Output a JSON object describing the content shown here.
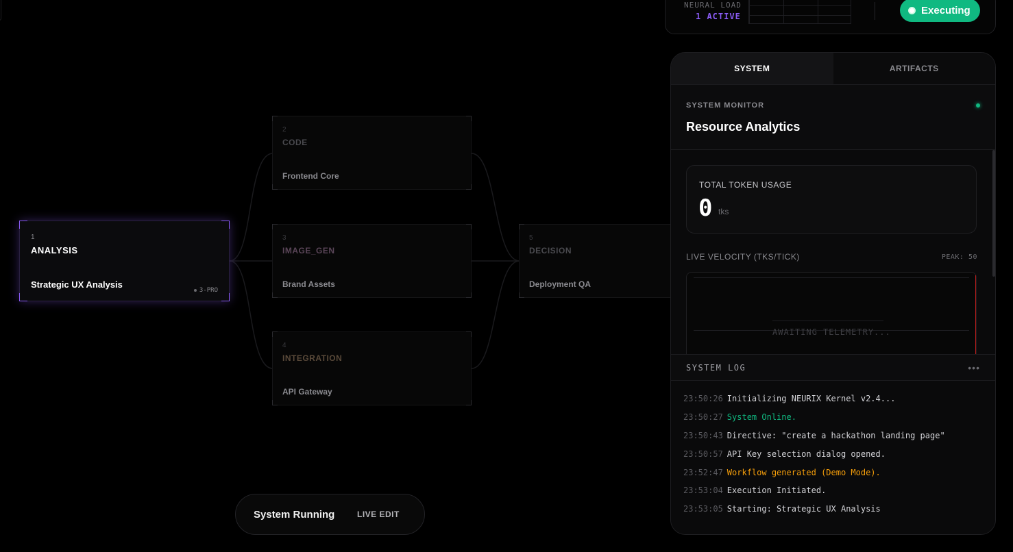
{
  "topbar": {
    "neural_label": "NEURAL LOAD",
    "neural_value": "1 ACTIVE",
    "exec_label": "Executing"
  },
  "nodes": [
    {
      "num": "1",
      "type": "ANALYSIS",
      "title": "Strategic UX Analysis",
      "model": "3-PRO"
    },
    {
      "num": "2",
      "type": "CODE",
      "title": "Frontend Core"
    },
    {
      "num": "3",
      "type": "IMAGE_GEN",
      "title": "Brand Assets"
    },
    {
      "num": "4",
      "type": "INTEGRATION",
      "title": "API Gateway"
    },
    {
      "num": "5",
      "type": "DECISION",
      "title": "Deployment QA"
    }
  ],
  "pill": {
    "status": "System Running",
    "edit": "LIVE EDIT"
  },
  "panel": {
    "tabs": [
      "SYSTEM",
      "ARTIFACTS"
    ],
    "monitor_label": "SYSTEM MONITOR",
    "monitor_title": "Resource Analytics",
    "token_label": "TOTAL TOKEN USAGE",
    "token_value": "0",
    "token_unit": "tks",
    "velocity_label": "LIVE VELOCITY (TKS/TICK)",
    "velocity_peak": "PEAK: 50",
    "awaiting": "AWAITING TELEMETRY...",
    "log_title": "SYSTEM LOG",
    "log_more": "•••"
  },
  "log": [
    {
      "time": "23:50:26",
      "msg": "Initializing NEURIX Kernel v2.4...",
      "tone": "normal"
    },
    {
      "time": "23:50:27",
      "msg": "System Online.",
      "tone": "green"
    },
    {
      "time": "23:50:43",
      "msg": "Directive: \"create a hackathon landing page\"",
      "tone": "normal"
    },
    {
      "time": "23:50:57",
      "msg": "API Key selection dialog opened.",
      "tone": "normal"
    },
    {
      "time": "23:52:47",
      "msg": "Workflow generated (Demo Mode).",
      "tone": "orange"
    },
    {
      "time": "23:53:04",
      "msg": "Execution Initiated.",
      "tone": "normal"
    },
    {
      "time": "23:53:05",
      "msg": "Starting: Strategic UX Analysis",
      "tone": "normal"
    }
  ],
  "colors": {
    "accent": "#8b5cf6",
    "success": "#10b981",
    "warning": "#f59e0b",
    "alert": "#b91c1c"
  }
}
